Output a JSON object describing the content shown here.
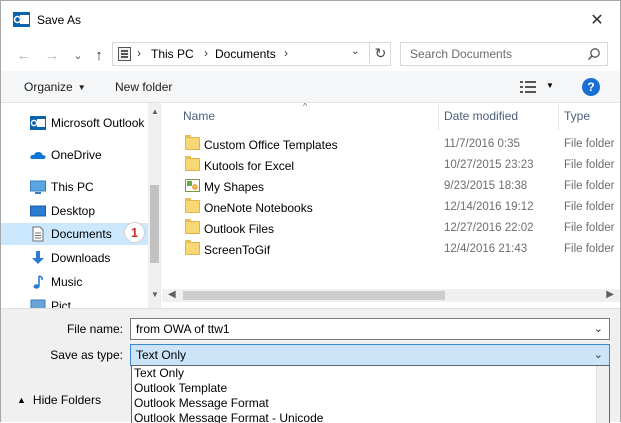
{
  "window": {
    "title": "Save As",
    "close_glyph": "✕"
  },
  "nav": {
    "back_glyph": "←",
    "forward_glyph": "→",
    "history_glyph": "⌄",
    "up_glyph": "↑",
    "breadcrumbs": [
      "This PC",
      "Documents"
    ],
    "crumb_sep": "›",
    "address_dropdown_glyph": "⌄",
    "refresh_glyph": "↻"
  },
  "search": {
    "placeholder": "Search Documents"
  },
  "toolbar": {
    "organize_label": "Organize",
    "new_folder_label": "New folder",
    "help_label": "?",
    "caret": "▼"
  },
  "sidebar": {
    "items": [
      {
        "label": "Microsoft Outlook",
        "icon": "outlook-icon"
      },
      {
        "label": "OneDrive",
        "icon": "onedrive-icon"
      },
      {
        "label": "This PC",
        "icon": "pc-icon"
      },
      {
        "label": "Desktop",
        "icon": "desktop-icon"
      },
      {
        "label": "Documents",
        "icon": "documents-icon",
        "selected": true
      },
      {
        "label": "Downloads",
        "icon": "downloads-icon"
      },
      {
        "label": "Music",
        "icon": "music-icon"
      },
      {
        "label": "Pict",
        "icon": "pictures-icon"
      }
    ],
    "step_badge": "1"
  },
  "filelist": {
    "columns": [
      "Name",
      "Date modified",
      "Type"
    ],
    "rows": [
      {
        "name": "Custom Office Templates",
        "date": "11/7/2016 0:35",
        "type": "File folder",
        "icon": "folder-icon"
      },
      {
        "name": "Kutools for Excel",
        "date": "10/27/2015 23:23",
        "type": "File folder",
        "icon": "folder-icon"
      },
      {
        "name": "My Shapes",
        "date": "9/23/2015 18:38",
        "type": "File folder",
        "icon": "shapes-folder-icon"
      },
      {
        "name": "OneNote Notebooks",
        "date": "12/14/2016 19:12",
        "type": "File folder",
        "icon": "folder-icon"
      },
      {
        "name": "Outlook Files",
        "date": "12/27/2016 22:02",
        "type": "File folder",
        "icon": "folder-icon"
      },
      {
        "name": "ScreenToGif",
        "date": "12/4/2016 21:43",
        "type": "File folder",
        "icon": "folder-icon"
      }
    ]
  },
  "form": {
    "filename_label": "File name:",
    "filename_value": "from OWA of ttw1",
    "savetype_label": "Save as type:",
    "savetype_value": "Text Only",
    "savetype_options": [
      "Text Only",
      "Outlook Template",
      "Outlook Message Format",
      "Outlook Message Format - Unicode"
    ],
    "hide_folders_label": "Hide Folders"
  },
  "colors": {
    "selection": "#cce8ff",
    "accent": "#1a6fd1",
    "badge_text": "#d32f2f"
  }
}
